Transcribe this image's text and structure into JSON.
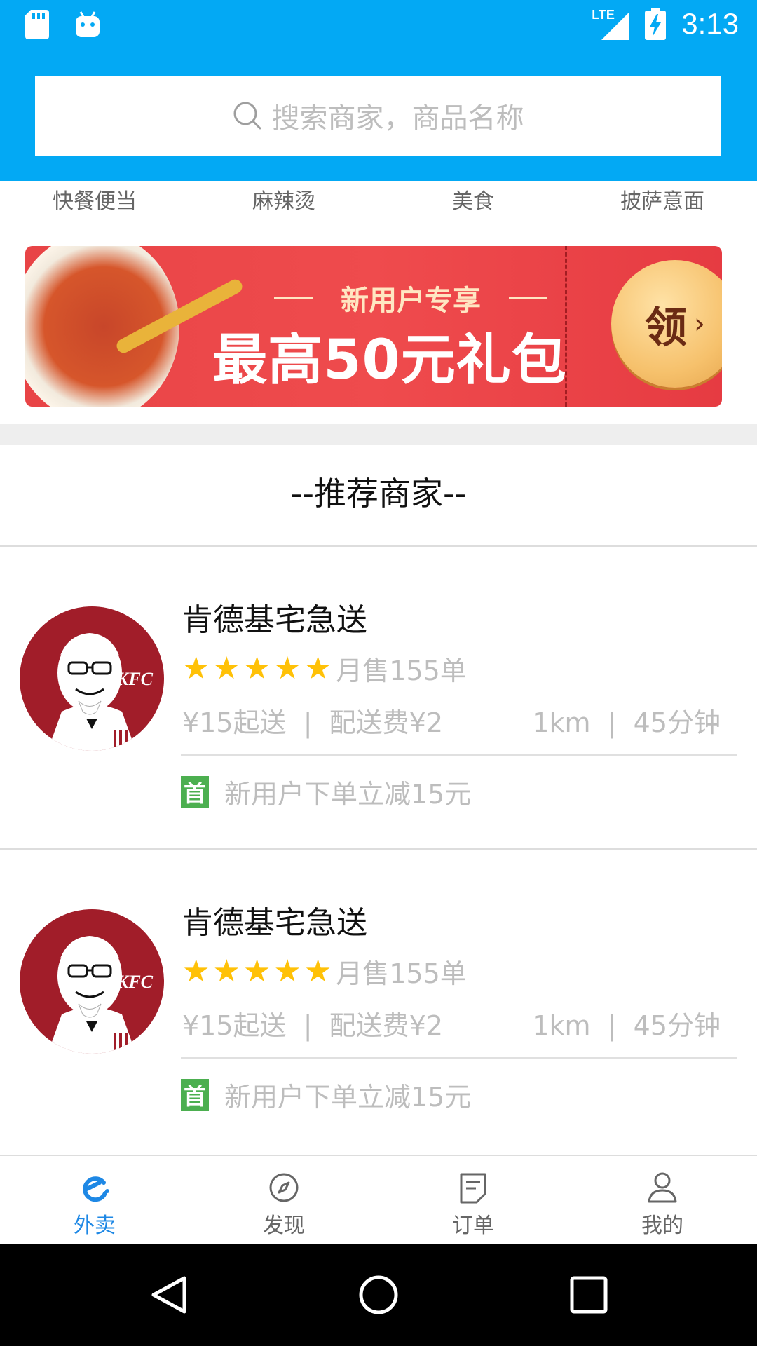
{
  "status_bar": {
    "network": "LTE",
    "time": "3:13"
  },
  "search": {
    "placeholder": "搜索商家，商品名称"
  },
  "categories": [
    {
      "label": "快餐便当"
    },
    {
      "label": "麻辣烫"
    },
    {
      "label": "美食"
    },
    {
      "label": "披萨意面"
    }
  ],
  "banner": {
    "subtitle": "新用户专享",
    "title": "最高50元礼包",
    "button": "领"
  },
  "section": {
    "title": "--推荐商家--"
  },
  "merchants": [
    {
      "name": "肯德基宅急送",
      "rating": 5,
      "monthly_sales": "月售155单",
      "min_order": "¥15起送",
      "delivery_fee": "配送费¥2",
      "distance": "1km",
      "delivery_time": "45分钟",
      "promo_badge": "首",
      "promo_text": "新用户下单立减15元",
      "logo_text": "KFC"
    },
    {
      "name": "肯德基宅急送",
      "rating": 5,
      "monthly_sales": "月售155单",
      "min_order": "¥15起送",
      "delivery_fee": "配送费¥2",
      "distance": "1km",
      "delivery_time": "45分钟",
      "promo_badge": "首",
      "promo_text": "新用户下单立减15元",
      "logo_text": "KFC"
    }
  ],
  "bottom_nav": [
    {
      "label": "外卖",
      "icon": "eleme-icon",
      "active": true
    },
    {
      "label": "发现",
      "icon": "compass-icon",
      "active": false
    },
    {
      "label": "订单",
      "icon": "order-icon",
      "active": false
    },
    {
      "label": "我的",
      "icon": "user-icon",
      "active": false
    }
  ],
  "colors": {
    "primary": "#03a9f4",
    "active_tab": "#1e88e5",
    "star": "#ffc107",
    "promo_badge": "#4caf50",
    "banner_red": "#e84446"
  }
}
